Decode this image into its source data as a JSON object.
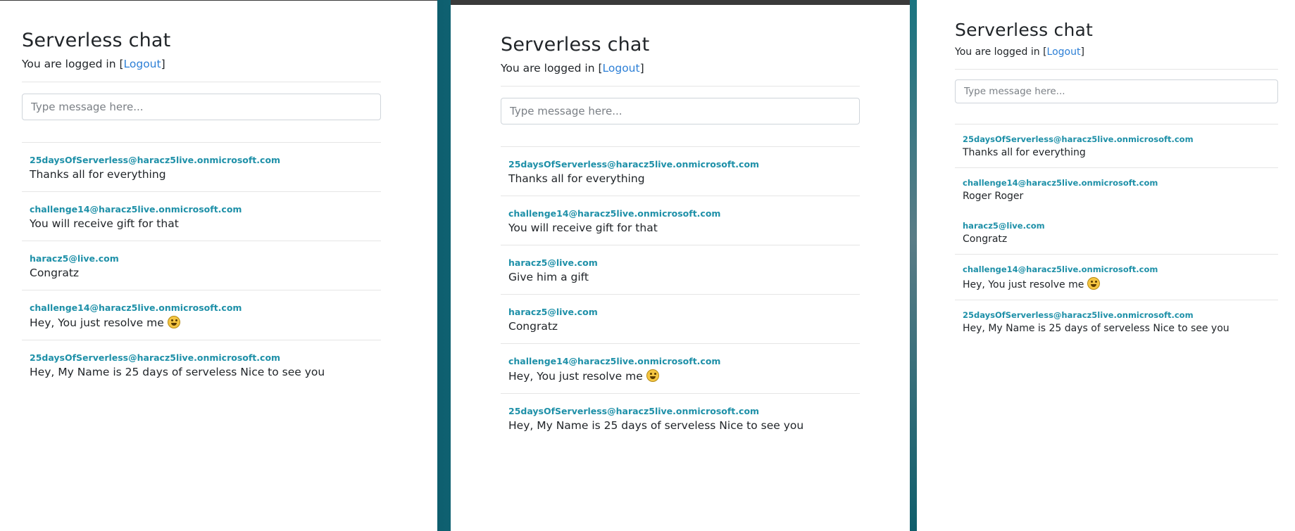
{
  "app": {
    "title": "Serverless chat",
    "login_prefix": "You are logged in [",
    "logout_label": "Logout",
    "login_suffix": "]",
    "input_placeholder": "Type message here..."
  },
  "colors": {
    "accent_link": "#2c7fd6",
    "sender": "#1e90a8",
    "background_teal": "#15707f"
  },
  "windows": [
    {
      "messages": [
        {
          "sender": "25daysOfServerless@haracz5live.onmicrosoft.com",
          "text": "Thanks all for everything"
        },
        {
          "sender": "challenge14@haracz5live.onmicrosoft.com",
          "text": "You will receive gift for that"
        },
        {
          "sender": "haracz5@live.com",
          "text": "Congratz"
        },
        {
          "sender": "challenge14@haracz5live.onmicrosoft.com",
          "text": "Hey, You just resolve me",
          "emoji": "grinning-face-icon"
        },
        {
          "sender": "25daysOfServerless@haracz5live.onmicrosoft.com",
          "text": "Hey, My Name is 25 days of serveless Nice to see you"
        }
      ]
    },
    {
      "messages": [
        {
          "sender": "25daysOfServerless@haracz5live.onmicrosoft.com",
          "text": "Thanks all for everything"
        },
        {
          "sender": "challenge14@haracz5live.onmicrosoft.com",
          "text": "You will receive gift for that"
        },
        {
          "sender": "haracz5@live.com",
          "text": "Give him a gift"
        },
        {
          "sender": "haracz5@live.com",
          "text": "Congratz"
        },
        {
          "sender": "challenge14@haracz5live.onmicrosoft.com",
          "text": "Hey, You just resolve me",
          "emoji": "grinning-face-icon"
        },
        {
          "sender": "25daysOfServerless@haracz5live.onmicrosoft.com",
          "text": "Hey, My Name is 25 days of serveless Nice to see you"
        }
      ]
    },
    {
      "messages": [
        {
          "sender": "25daysOfServerless@haracz5live.onmicrosoft.com",
          "text": "Thanks all for everything"
        },
        {
          "sender": "challenge14@haracz5live.onmicrosoft.com",
          "text": "Roger Roger"
        },
        {
          "sender": "haracz5@live.com",
          "text": "Congratz"
        },
        {
          "sender": "challenge14@haracz5live.onmicrosoft.com",
          "text": "Hey, You just resolve me",
          "emoji": "grinning-face-icon"
        },
        {
          "sender": "25daysOfServerless@haracz5live.onmicrosoft.com",
          "text": "Hey, My Name is 25 days of serveless Nice to see you"
        }
      ]
    }
  ]
}
